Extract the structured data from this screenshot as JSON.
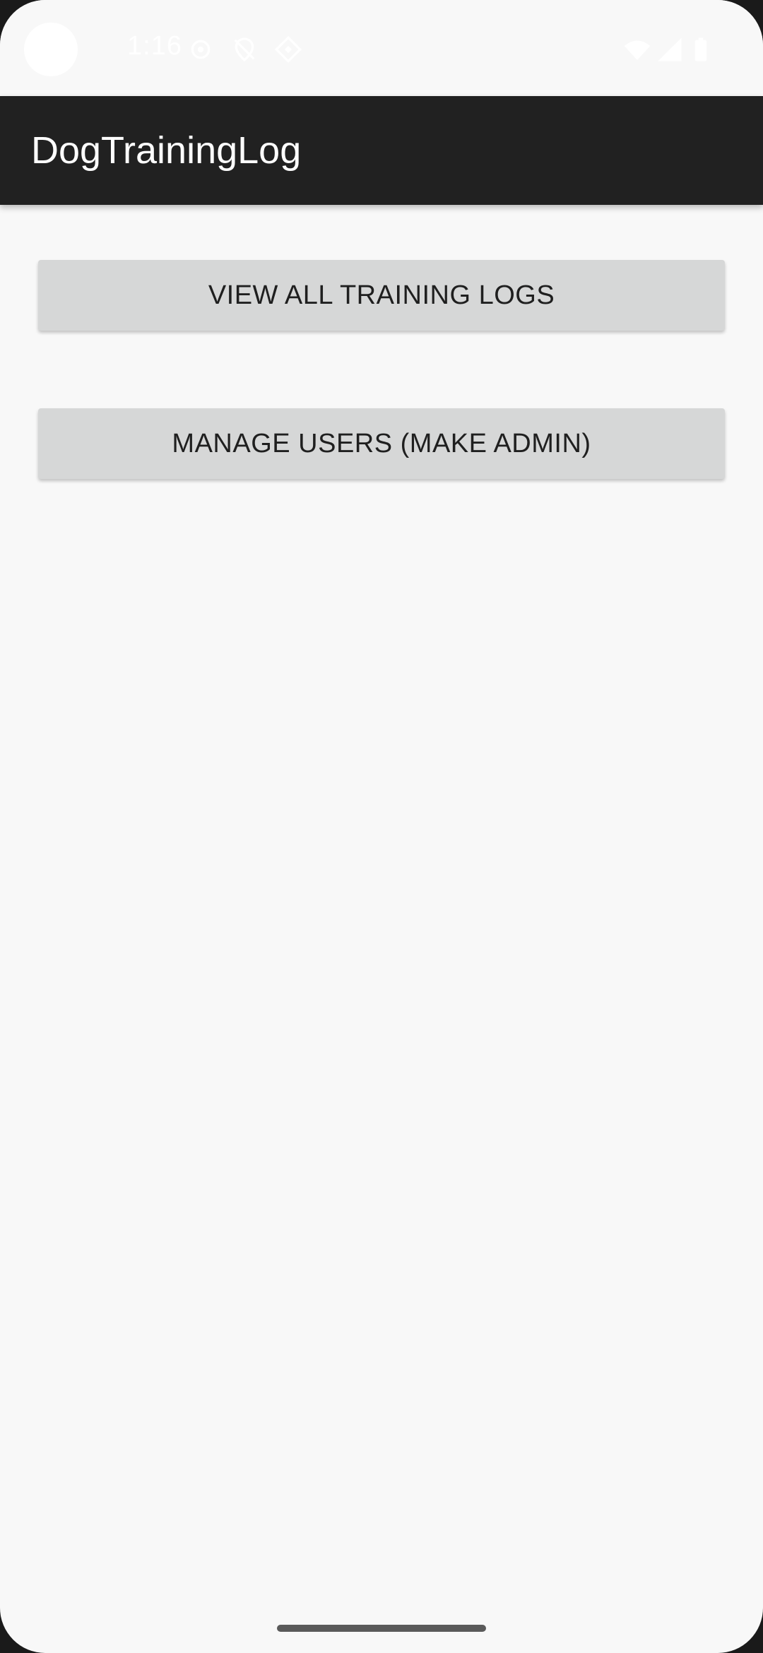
{
  "status_bar": {
    "time": "1:16",
    "icons": [
      "settings-icon",
      "location-off-icon",
      "vpn-diamond-icon",
      "wifi-icon",
      "signal-icon",
      "battery-icon"
    ]
  },
  "app_bar": {
    "title": "DogTrainingLog",
    "background": "#212121"
  },
  "main": {
    "view_logs_label": "VIEW ALL TRAINING LOGS",
    "manage_users_label": "MANAGE USERS (MAKE ADMIN)",
    "button_color": "#d6d7d7"
  }
}
